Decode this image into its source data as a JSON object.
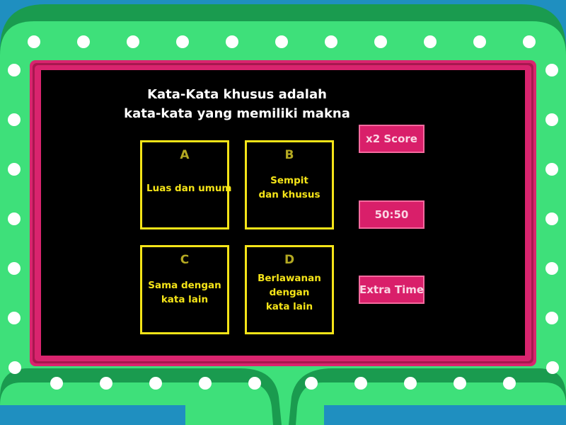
{
  "colors": {
    "background": "#1f8fc0",
    "outer_frame": "#1a9b4f",
    "inner_frame": "#3ee07a",
    "screen_border": "#d9246e",
    "screen": "#000000",
    "answer_border": "#f5e418",
    "powerup": "#d91f6a",
    "bulb": "#ffffff"
  },
  "question": {
    "lines": [
      "Kata-Kata khusus adalah",
      "kata-kata yang memiliki makna"
    ]
  },
  "answers": [
    {
      "letter": "A",
      "lines": [
        "Luas dan umum"
      ]
    },
    {
      "letter": "B",
      "lines": [
        "Sempit",
        "dan khusus"
      ]
    },
    {
      "letter": "C",
      "lines": [
        "Sama dengan",
        "kata lain"
      ]
    },
    {
      "letter": "D",
      "lines": [
        "Berlawanan",
        "dengan",
        "kata lain"
      ]
    }
  ],
  "powerups": {
    "double_score": "x2 Score",
    "fifty_fifty": "50:50",
    "extra_time": "Extra Time"
  }
}
